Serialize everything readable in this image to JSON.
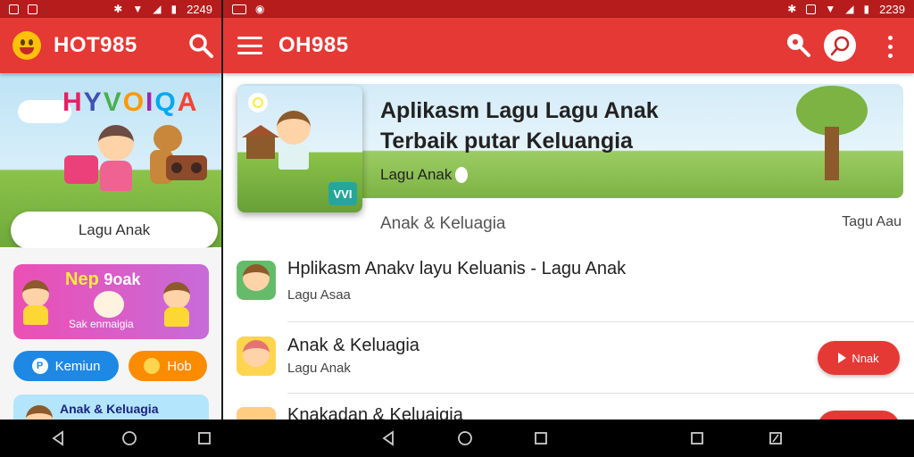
{
  "left_status": {
    "time": "2249"
  },
  "right_status": {
    "time": "2239"
  },
  "left": {
    "app_title": "HOT985",
    "hero_title": [
      "H",
      "Y",
      "V",
      "O",
      "I",
      "Q",
      "A"
    ],
    "lagu_button": "Lagu Anak",
    "pink_card": {
      "title_a": "Nep",
      "title_b": "9oak",
      "subtitle": "Sak enmaigia"
    },
    "pill_blue": {
      "icon": "P",
      "label": "Kemiun"
    },
    "pill_orange": {
      "label": "Hob"
    },
    "blue_card": {
      "title": "Anak & Keluagia"
    }
  },
  "right": {
    "app_title": "OH985",
    "banner": {
      "line1": "Aplikasm Lagu  Lagu Anak",
      "line2": "Terbaik putar Keluangia",
      "line3": "Lagu Anak",
      "badge": "VVI"
    },
    "section": {
      "title": "Anak & Keluagia",
      "more": "Tagu Aau"
    },
    "list": [
      {
        "title": "Hplikasm Anakv layu Keluanis - Lagu Anak",
        "subtitle": "Lagu Asaa"
      },
      {
        "title": "Anak & Keluagia",
        "subtitle": "Lagu Anak",
        "button": "Nnak"
      },
      {
        "title": "Knakadan & Keluaigia",
        "subtitle": ""
      }
    ]
  },
  "colors": {
    "accent": "#e53935",
    "status": "#b71c1c",
    "pill_blue": "#1e88e5",
    "pill_orange": "#fb8c00"
  }
}
